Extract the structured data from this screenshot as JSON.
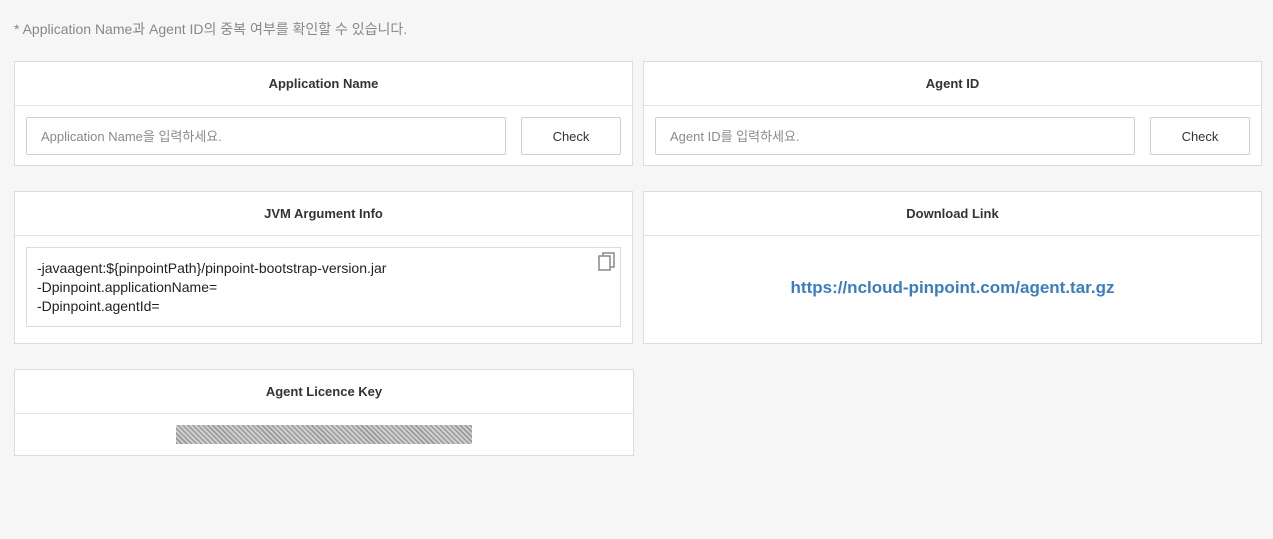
{
  "notice": "* Application Name과 Agent ID의 중복 여부를 확인할 수 있습니다.",
  "application_name": {
    "title": "Application Name",
    "placeholder": "Application Name을 입력하세요.",
    "button": "Check"
  },
  "agent_id": {
    "title": "Agent ID",
    "placeholder": "Agent ID를 입력하세요.",
    "button": "Check"
  },
  "jvm": {
    "title": "JVM Argument Info",
    "lines": [
      "-javaagent:${pinpointPath}/pinpoint-bootstrap-version.jar",
      "-Dpinpoint.applicationName=",
      "-Dpinpoint.agentId="
    ],
    "copy_icon": "copy-icon"
  },
  "download": {
    "title": "Download Link",
    "url": "https://ncloud-pinpoint.com/agent.tar.gz"
  },
  "licence": {
    "title": "Agent Licence Key",
    "value_state": "masked"
  },
  "colors": {
    "background": "#f6f6f6",
    "link": "#3d7cc2",
    "border": "#dcdcdc"
  }
}
